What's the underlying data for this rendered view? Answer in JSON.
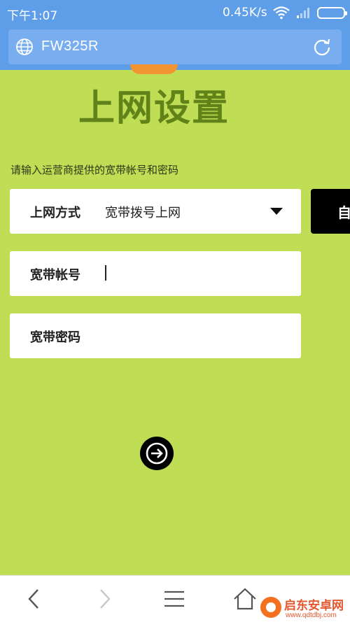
{
  "status_bar": {
    "time": "下午1:07",
    "network_speed": "0.45K/s",
    "wifi_icon": "wifi-icon",
    "signal_icon": "signal-icon",
    "battery_icon": "battery-icon"
  },
  "browser": {
    "url": "FW325R",
    "globe_icon": "globe-icon",
    "refresh_icon": "refresh-icon"
  },
  "page": {
    "title": "上网设置",
    "hint": "请输入运营商提供的宽带帐号和密码",
    "side_tab_label": "自"
  },
  "form": {
    "mode": {
      "label": "上网方式",
      "value": "宽带拨号上网",
      "icon": "dropdown-arrow-icon"
    },
    "account": {
      "label": "宽带帐号",
      "value": ""
    },
    "password": {
      "label": "宽带密码",
      "value": ""
    }
  },
  "next_icon": "arrow-right-icon",
  "bottom_nav": {
    "icons": [
      "back-icon",
      "forward-icon",
      "menu-icon",
      "home-icon"
    ]
  },
  "watermark": {
    "title": "启东安卓网",
    "url": "www.qdtdbj.com"
  },
  "colors": {
    "page_bg": "#bfdd55",
    "title": "#608218",
    "browser_bar": "#5e9de8",
    "url_box": "#78aef0"
  }
}
